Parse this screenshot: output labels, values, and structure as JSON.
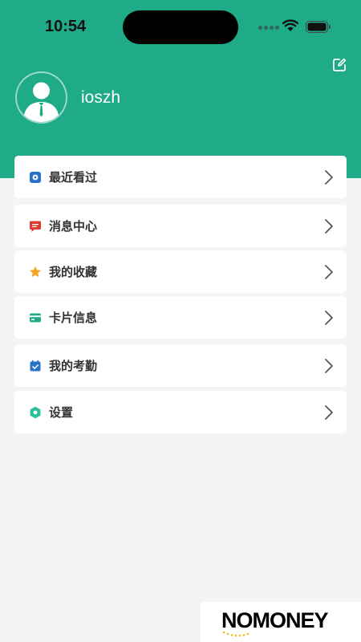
{
  "status_bar": {
    "time": "10:54"
  },
  "profile": {
    "username": "ioszh"
  },
  "menu": {
    "items": [
      {
        "label": "最近看过",
        "icon": "recent-icon",
        "color": "#2870c8"
      },
      {
        "label": "消息中心",
        "icon": "message-icon",
        "color": "#e0392f"
      },
      {
        "label": "我的收藏",
        "icon": "star-icon",
        "color": "#f6a623"
      },
      {
        "label": "卡片信息",
        "icon": "card-icon",
        "color": "#1fab87"
      },
      {
        "label": "我的考勤",
        "icon": "calendar-icon",
        "color": "#2870c8"
      },
      {
        "label": "设置",
        "icon": "gear-icon",
        "color": "#2bbf9a"
      }
    ]
  },
  "theme": {
    "accent": "#1fab87",
    "background": "#f4f4f4"
  },
  "logo": {
    "text": "NOMONEY"
  }
}
